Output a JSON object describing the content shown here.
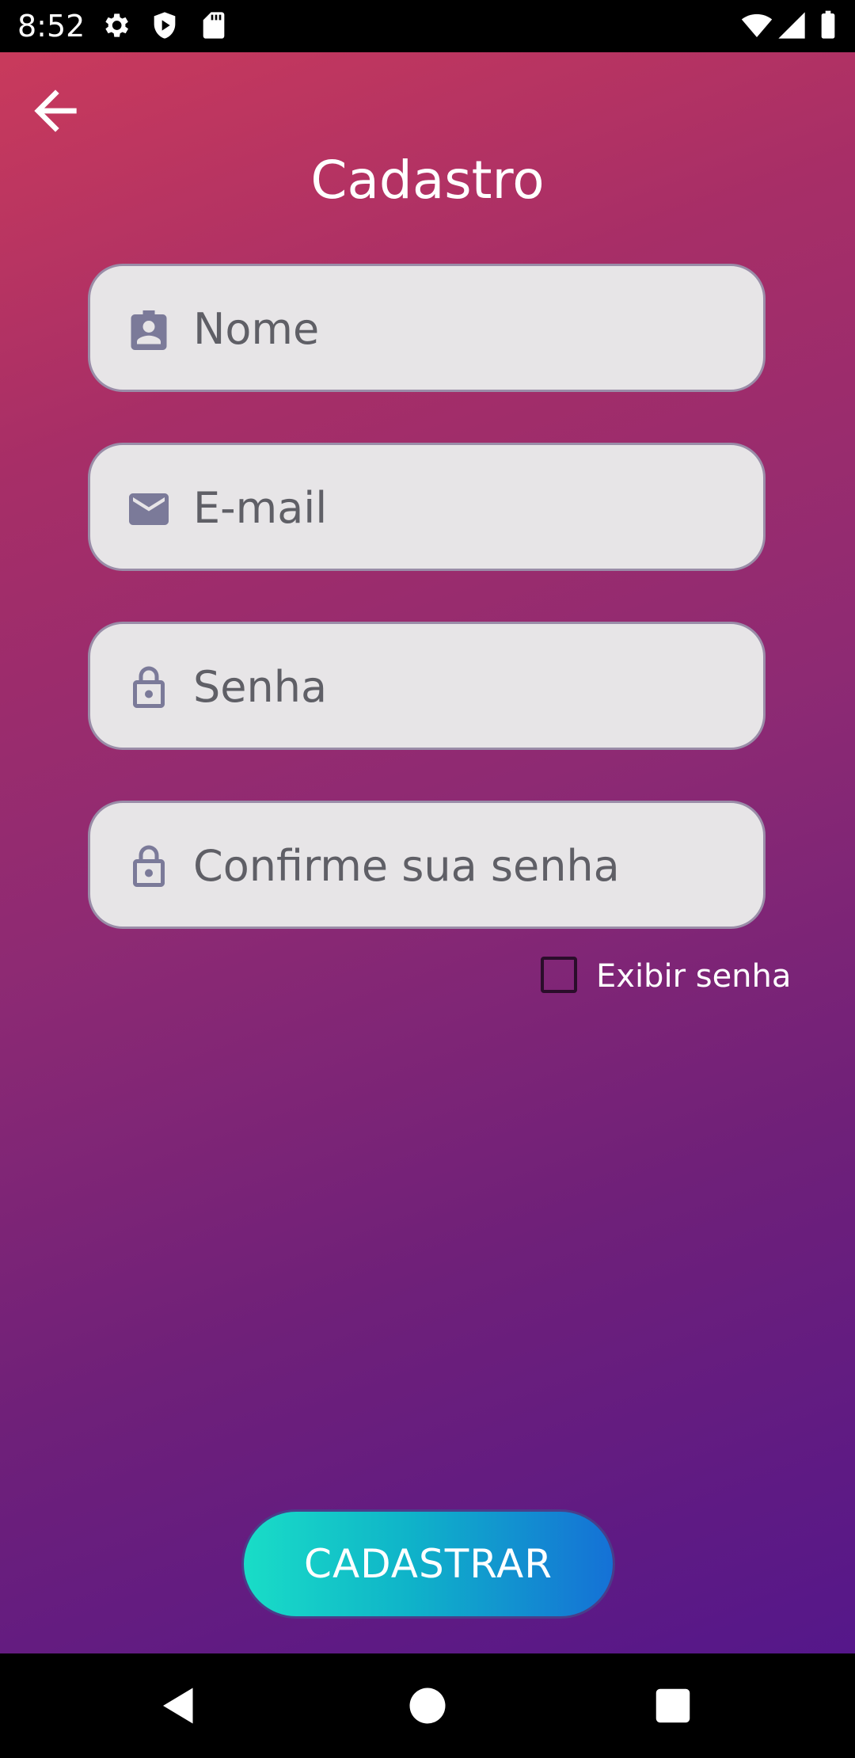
{
  "status_bar": {
    "time": "8:52",
    "icons": [
      "settings-icon",
      "shield-play-icon",
      "sd-card-icon",
      "wifi-icon",
      "signal-icon",
      "battery-icon"
    ]
  },
  "header": {
    "back_icon": "arrow-left-icon",
    "title": "Cadastro"
  },
  "form": {
    "fields": [
      {
        "icon": "contact-badge-icon",
        "placeholder": "Nome",
        "value": ""
      },
      {
        "icon": "mail-icon",
        "placeholder": "E-mail",
        "value": ""
      },
      {
        "icon": "lock-icon",
        "placeholder": "Senha",
        "value": ""
      },
      {
        "icon": "lock-icon",
        "placeholder": "Confirme sua senha",
        "value": ""
      }
    ],
    "show_password": {
      "label": "Exibir senha",
      "checked": false
    }
  },
  "submit": {
    "label": "CADASTRAR"
  },
  "nav_bar": {
    "icons": [
      "back-triangle-icon",
      "home-circle-icon",
      "recents-square-icon"
    ]
  },
  "colors": {
    "gradient_start": "#c93a5c",
    "gradient_end": "#55178a",
    "field_bg": "#e7e5e7",
    "icon_color": "#7b7a99",
    "button_start": "#19ddc7",
    "button_end": "#1571d6"
  }
}
